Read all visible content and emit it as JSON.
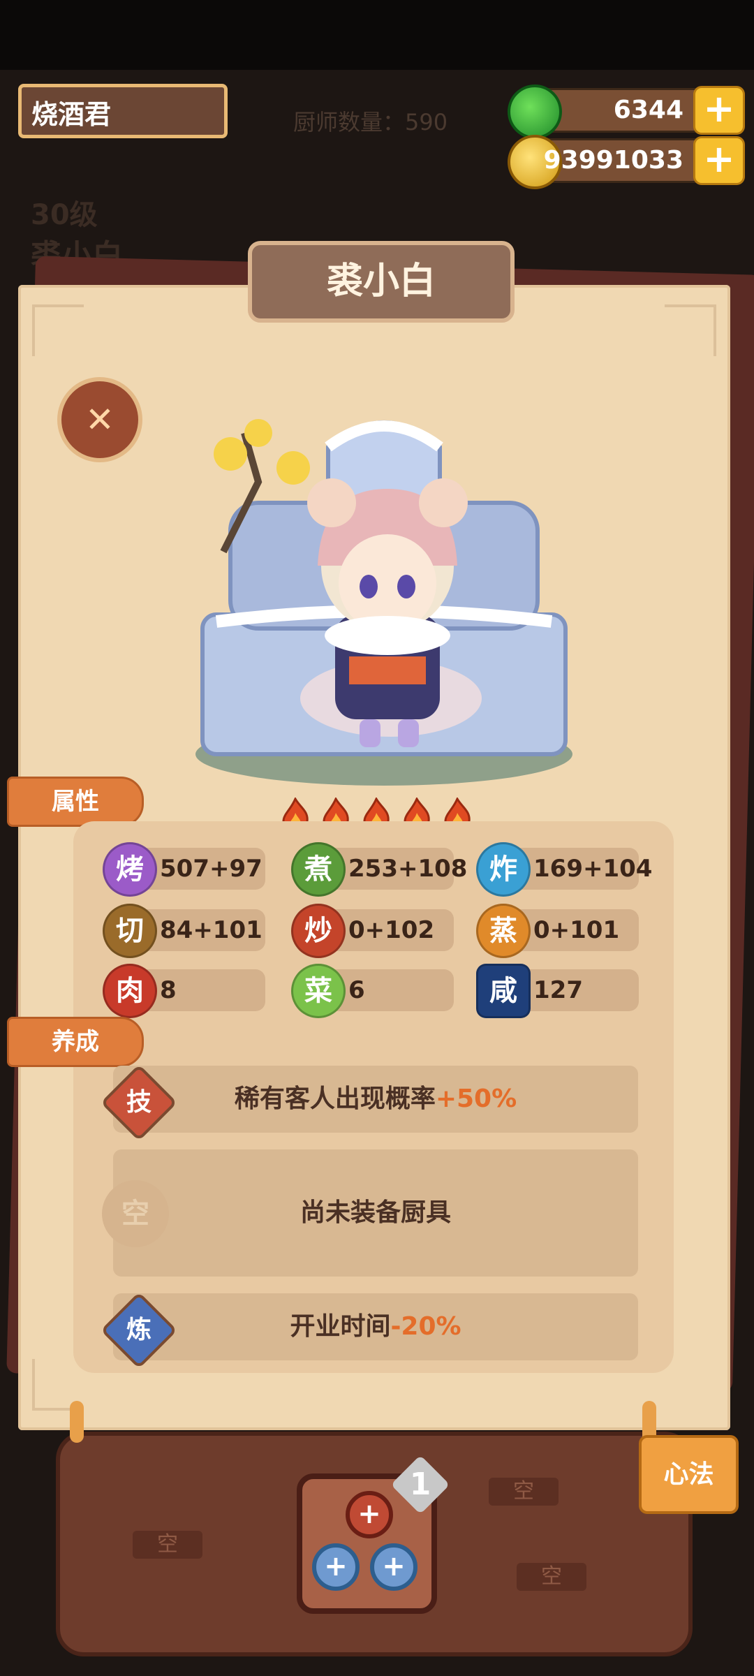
{
  "header": {
    "player_name": "烧酒君",
    "chef_count": "厨师数量：590"
  },
  "currency": {
    "jade": "6344",
    "coins": "93991033",
    "plus_label": "+"
  },
  "background": {
    "level": "30级",
    "name": "裘小白"
  },
  "chef": {
    "name": "裘小白",
    "rarity_flames": 5
  },
  "tabs": {
    "attributes": "属性",
    "training": "养成"
  },
  "stats": [
    {
      "icon": "烤",
      "value": "507+97",
      "color": "#9b5bc8"
    },
    {
      "icon": "煮",
      "value": "253+108",
      "color": "#5b9c3a"
    },
    {
      "icon": "炸",
      "value": "169+104",
      "color": "#3aa0d4"
    },
    {
      "icon": "切",
      "value": "84+101",
      "color": "#9a6b2a"
    },
    {
      "icon": "炒",
      "value": "0+102",
      "color": "#c4442a"
    },
    {
      "icon": "蒸",
      "value": "0+101",
      "color": "#e08a2a"
    },
    {
      "icon": "肉",
      "value": "8",
      "color": "#c83a2a"
    },
    {
      "icon": "菜",
      "value": "6",
      "color": "#7bc24a"
    },
    {
      "icon": "咸",
      "value": "127",
      "color": "#1f3f7a"
    }
  ],
  "training": {
    "skill_badge": "技",
    "skill_text": "稀有客人出现概率",
    "skill_value": "+50%",
    "equip_badge": "空",
    "equip_text": "尚未装备厨具",
    "refine_badge": "炼",
    "refine_text": "开业时间",
    "refine_value": "-20%"
  },
  "bottom": {
    "xinfa": "心法",
    "level_badge": "1",
    "empty": "空"
  }
}
